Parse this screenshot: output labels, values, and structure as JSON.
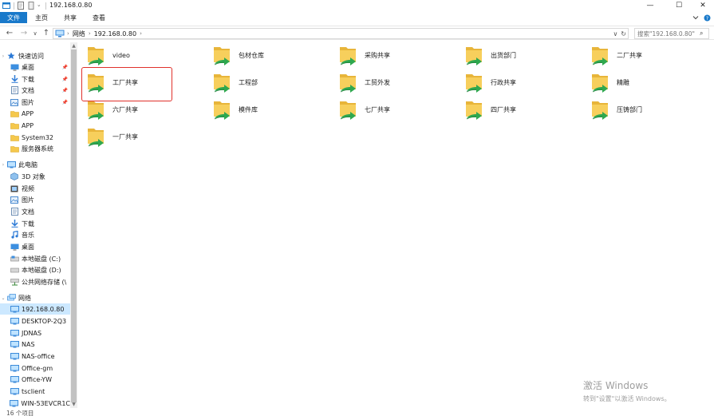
{
  "window": {
    "title": "192.168.0.80",
    "controls": {
      "minimize": "—",
      "maximize": "☐",
      "close": "✕"
    }
  },
  "ribbon": {
    "tabs": [
      {
        "label": "文件",
        "active": true
      },
      {
        "label": "主页"
      },
      {
        "label": "共享"
      },
      {
        "label": "查看"
      }
    ],
    "collapse_icon": "chevron-down-icon",
    "help_icon": "help-icon"
  },
  "address": {
    "back_icon": "←",
    "forward_icon": "→",
    "dropdown_icon": "∨",
    "up_icon": "↑",
    "crumbs": [
      "网络",
      "192.168.0.80"
    ],
    "refresh_icon": "↻",
    "search_placeholder": "搜索\"192.168.0.80\""
  },
  "navpane": {
    "quick_access": "快速访问",
    "quick_items": [
      {
        "label": "桌面",
        "icon": "desktop-icon",
        "pinned": true
      },
      {
        "label": "下载",
        "icon": "download-icon",
        "pinned": true
      },
      {
        "label": "文档",
        "icon": "document-icon",
        "pinned": true
      },
      {
        "label": "图片",
        "icon": "picture-icon",
        "pinned": true
      },
      {
        "label": "APP",
        "icon": "folder-icon"
      },
      {
        "label": "APP",
        "icon": "folder-icon"
      },
      {
        "label": "System32",
        "icon": "folder-icon"
      },
      {
        "label": "服务器系统",
        "icon": "folder-icon"
      }
    ],
    "this_pc": "此电脑",
    "pc_items": [
      {
        "label": "3D 对象",
        "icon": "3d-objects-icon"
      },
      {
        "label": "视频",
        "icon": "video-icon"
      },
      {
        "label": "图片",
        "icon": "picture-icon"
      },
      {
        "label": "文档",
        "icon": "document-icon"
      },
      {
        "label": "下载",
        "icon": "download-icon"
      },
      {
        "label": "音乐",
        "icon": "music-icon"
      },
      {
        "label": "桌面",
        "icon": "desktop-icon"
      },
      {
        "label": "本地磁盘 (C:)",
        "icon": "drive-icon"
      },
      {
        "label": "本地磁盘 (D:)",
        "icon": "drive-icon"
      },
      {
        "label": "公共网络存储 (\\",
        "icon": "network-drive-icon"
      }
    ],
    "network": "网络",
    "net_items": [
      {
        "label": "192.168.0.80",
        "selected": true
      },
      {
        "label": "DESKTOP-2Q3"
      },
      {
        "label": "JDNAS"
      },
      {
        "label": "NAS"
      },
      {
        "label": "NAS-office"
      },
      {
        "label": "Office-gm"
      },
      {
        "label": "Office-YW"
      },
      {
        "label": "tsclient"
      },
      {
        "label": "WIN-53EVCR1C"
      }
    ]
  },
  "content": {
    "folders": [
      "video",
      "包材仓库",
      "采购共享",
      "出货部门",
      "二厂共享",
      "工厂共享",
      "工程部",
      "工贸外发",
      "行政共享",
      "精雕",
      "六厂共享",
      "模件库",
      "七厂共享",
      "四厂共享",
      "压铸部门",
      "一厂共享"
    ],
    "highlighted_folder": "工厂共享"
  },
  "status": {
    "count": "16 个项目"
  },
  "watermark": {
    "line1": "激活 Windows",
    "line2": "转到\"设置\"以激活 Windows。"
  },
  "colors": {
    "accent": "#1979ca",
    "selection": "#cce8ff",
    "highlight_border": "#e0312b",
    "folder": "#f5c84c"
  }
}
